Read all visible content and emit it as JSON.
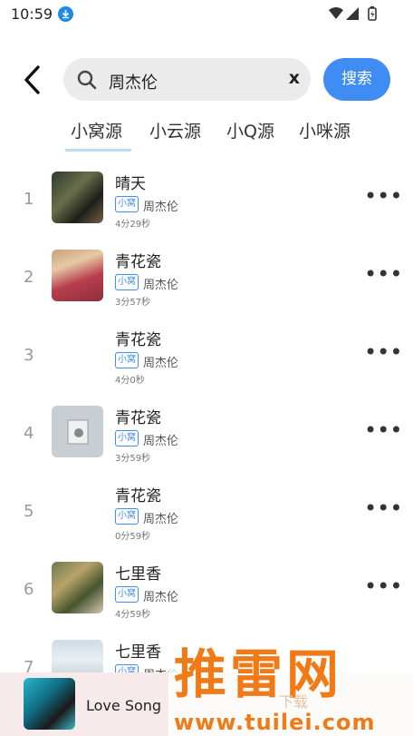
{
  "status_bar": {
    "time": "10:59"
  },
  "search": {
    "query": "周杰伦",
    "clear_label": "x",
    "button_label": "搜索"
  },
  "tabs": [
    "小窝源",
    "小云源",
    "小Q源",
    "小咪源"
  ],
  "songs": [
    {
      "index": "1",
      "title": "晴天",
      "tag": "小窝",
      "artist": "周杰伦",
      "duration": "4分29秒"
    },
    {
      "index": "2",
      "title": "青花瓷",
      "tag": "小窝",
      "artist": "周杰伦",
      "duration": "3分57秒"
    },
    {
      "index": "3",
      "title": "青花瓷",
      "tag": "小窝",
      "artist": "周杰伦",
      "duration": "4分0秒"
    },
    {
      "index": "4",
      "title": "青花瓷",
      "tag": "小窝",
      "artist": "周杰伦",
      "duration": "3分59秒"
    },
    {
      "index": "5",
      "title": "青花瓷",
      "tag": "小窝",
      "artist": "周杰伦",
      "duration": "0分59秒"
    },
    {
      "index": "6",
      "title": "七里香",
      "tag": "小窝",
      "artist": "周杰伦",
      "duration": "4分59秒"
    },
    {
      "index": "7",
      "title": "七里香",
      "tag": "小窝",
      "artist": "周杰伦",
      "duration": ""
    }
  ],
  "more_label": "•••",
  "now_playing": {
    "title": "Love Song"
  },
  "watermark": {
    "text": "推雷网",
    "small": "下载",
    "url": "www.tuilei.com"
  },
  "colors": {
    "accent": "#3f8cf5",
    "tab_indicator": "#b9dcef",
    "player_bg": "#f6eaea",
    "watermark": "#f07a16"
  }
}
